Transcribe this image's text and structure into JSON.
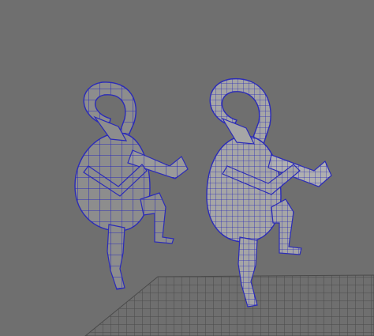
{
  "viewport": {
    "background": "#6f6f6f",
    "grid_color": "#4a4a4a",
    "mesh_color": "#2b2bb8",
    "low_poly_fill": "#8d8d8d",
    "high_poly_fill": "#a6a6a6",
    "objects": [
      "low-poly-figure",
      "smooth-figure"
    ]
  }
}
